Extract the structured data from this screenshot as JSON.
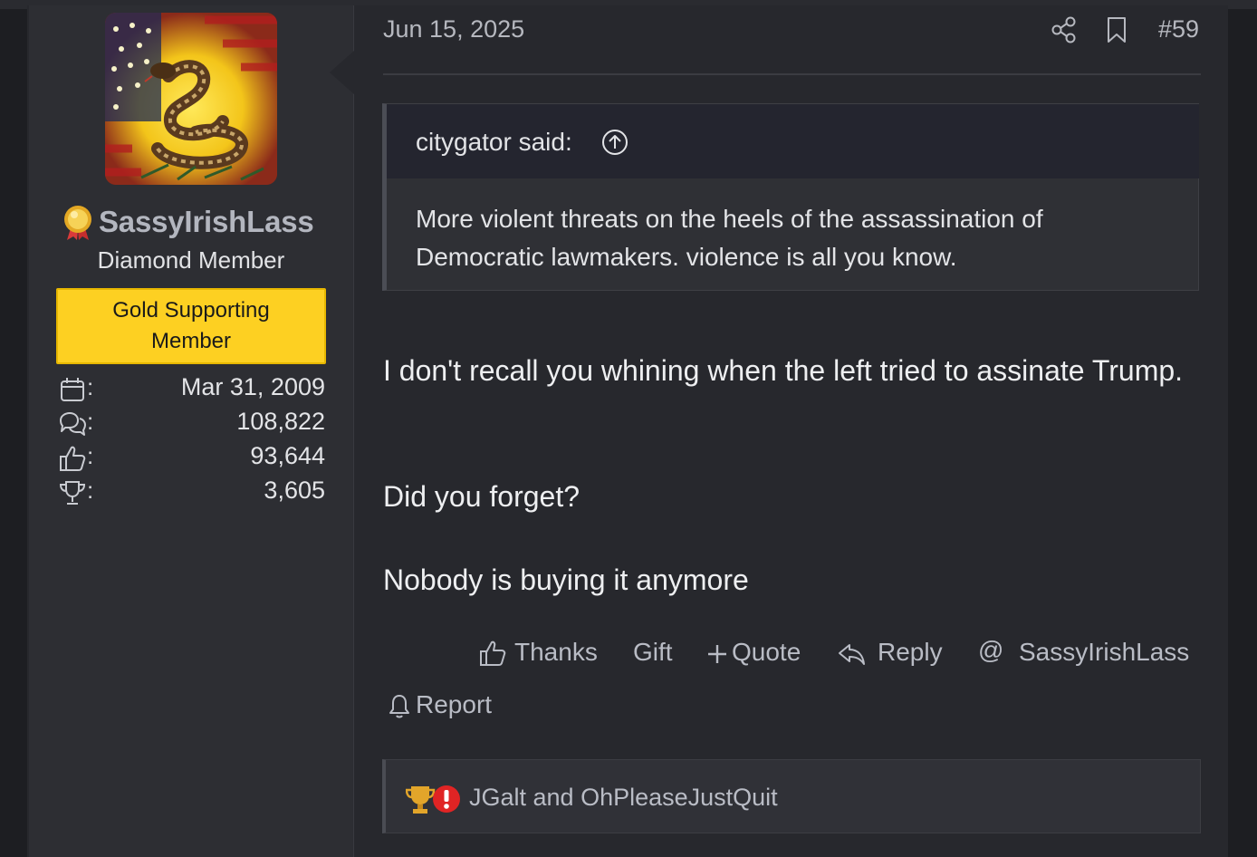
{
  "post": {
    "date": "Jun 15, 2025",
    "number": "#59"
  },
  "user": {
    "name": "SassyIrishLass",
    "title": "Diamond Member",
    "banner": "Gold Supporting Member",
    "stats": [
      {
        "icon": "calendar-icon",
        "colon": ":",
        "value": "Mar 31, 2009"
      },
      {
        "icon": "messages-icon",
        "colon": ":",
        "value": "108,822"
      },
      {
        "icon": "thumbs-up-icon",
        "colon": ":",
        "value": "93,644"
      },
      {
        "icon": "trophy-icon",
        "colon": ":",
        "value": "3,605"
      }
    ]
  },
  "quote": {
    "author": "citygator said:",
    "text": "More violent threats on the heels of the assassination of Democratic lawmakers. violence is all you know."
  },
  "body": {
    "p1": "I don't recall you whining when the left tried to assinate Trump.",
    "p2": "Did you forget?",
    "p3": "Nobody is buying it anymore"
  },
  "actions": {
    "thanks": "Thanks",
    "gift": "Gift",
    "quote": "Quote",
    "reply": "Reply",
    "mention": "SassyIrishLass",
    "report": "Report"
  },
  "reactions": {
    "users": "JGalt and OhPleaseJustQuit"
  },
  "colors": {
    "background": "#27282d",
    "banner": "#fdd022",
    "text": "#e3e4e7",
    "muted": "#b9bcc5"
  }
}
